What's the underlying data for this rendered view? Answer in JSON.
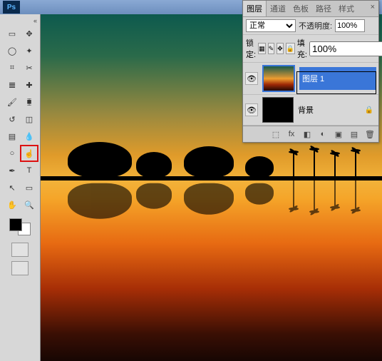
{
  "app": {
    "logo": "Ps"
  },
  "window_controls": {
    "min": "–",
    "max": "□",
    "close": "×"
  },
  "tools": [
    "marquee",
    "move",
    "lasso",
    "magic-wand",
    "crop",
    "slice",
    "eyedropper",
    "healing",
    "brush",
    "stamp",
    "history-brush",
    "eraser",
    "gradient",
    "blur",
    "dodge",
    "burn",
    "pen",
    "type",
    "path-select",
    "shape",
    "hand",
    "zoom"
  ],
  "highlighted_tool": "burn",
  "panel": {
    "tabs": [
      "图层",
      "通道",
      "色板",
      "路径",
      "样式"
    ],
    "active_tab": "图层",
    "close": "×",
    "blend_mode_label": "正常",
    "opacity_label": "不透明度:",
    "opacity_value": "100%",
    "lock_label": "锁定:",
    "fill_label": "填充:",
    "fill_value": "100%",
    "layers": [
      {
        "name": "图层 1",
        "selected": true,
        "thumb": "t1"
      },
      {
        "name": "背景",
        "selected": false,
        "thumb": "t2",
        "locked": true
      }
    ],
    "footer_icons": [
      "fx",
      "mask",
      "adjust",
      "group",
      "new",
      "trash"
    ]
  }
}
